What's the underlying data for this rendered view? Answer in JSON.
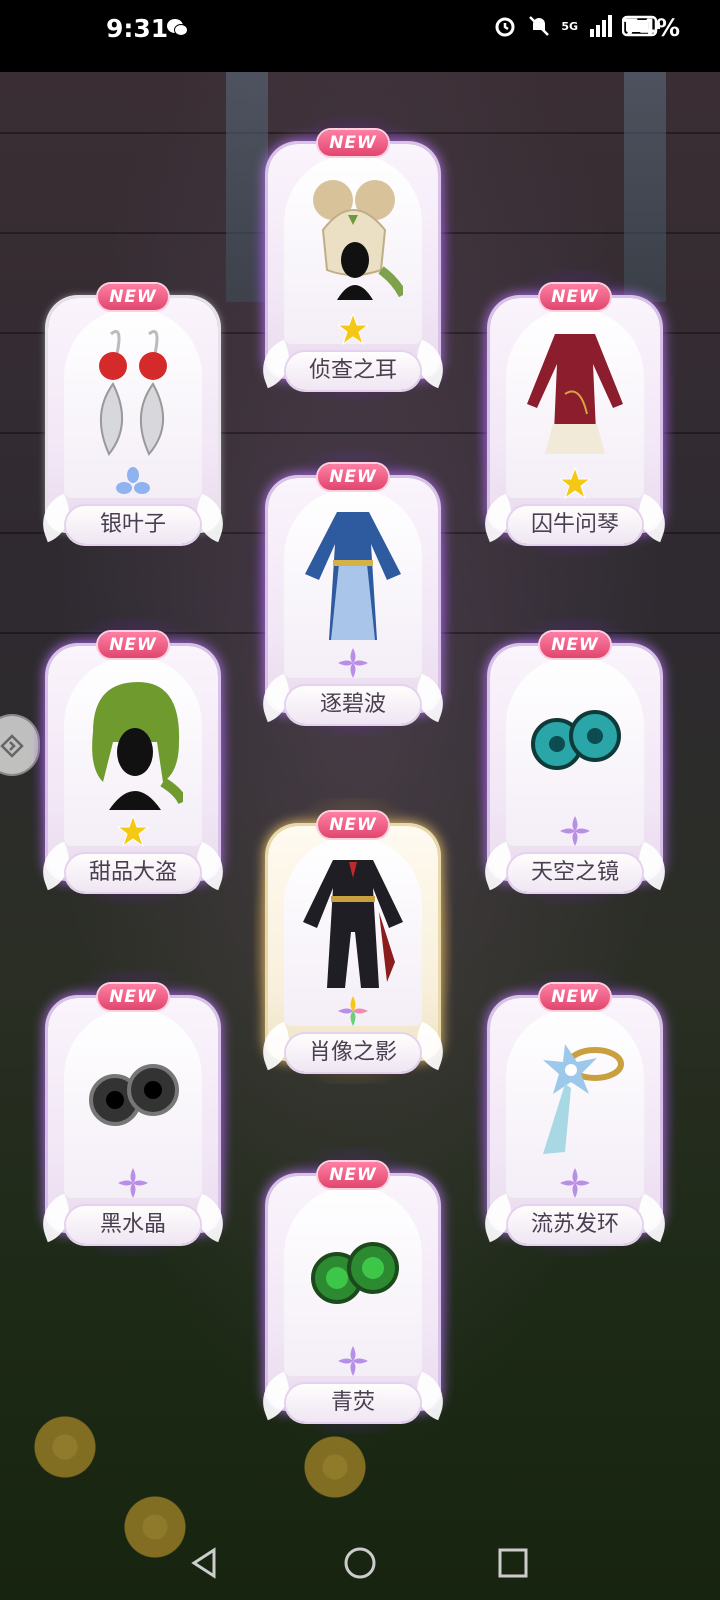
{
  "status_bar": {
    "time": "9:31",
    "network": "5G",
    "battery": "74%"
  },
  "cards": [
    {
      "name": "侦查之耳",
      "badge": "NEW",
      "gem": "yellow",
      "frame": "purple"
    },
    {
      "name": "银叶子",
      "badge": "NEW",
      "gem": "blue",
      "frame": "white"
    },
    {
      "name": "囚牛问琴",
      "badge": "NEW",
      "gem": "yellow",
      "frame": "purple"
    },
    {
      "name": "逐碧波",
      "badge": "NEW",
      "gem": "purple",
      "frame": "purple"
    },
    {
      "name": "甜品大盗",
      "badge": "NEW",
      "gem": "yellow",
      "frame": "purple"
    },
    {
      "name": "天空之镜",
      "badge": "NEW",
      "gem": "purple",
      "frame": "purple"
    },
    {
      "name": "肖像之影",
      "badge": "NEW",
      "gem": "rainbow",
      "frame": "gold"
    },
    {
      "name": "黑水晶",
      "badge": "NEW",
      "gem": "purple",
      "frame": "purple"
    },
    {
      "name": "流苏发环",
      "badge": "NEW",
      "gem": "purple",
      "frame": "purple"
    },
    {
      "name": "青荧",
      "badge": "NEW",
      "gem": "purple",
      "frame": "purple"
    }
  ],
  "colors": {
    "gem_yellow": "#f4c814",
    "gem_purple": "#b98ee8",
    "gem_blue": "#8fb3ee",
    "badge": "#e0466e"
  }
}
